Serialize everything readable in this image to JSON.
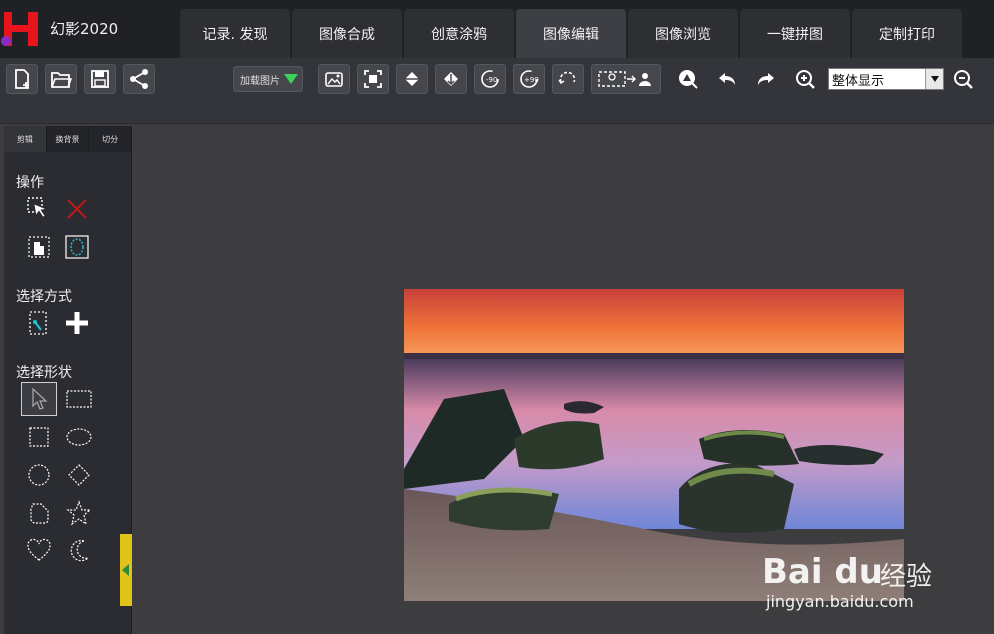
{
  "app": {
    "title": "幻影2020"
  },
  "tabs": [
    {
      "label": "记录. 发现"
    },
    {
      "label": "图像合成"
    },
    {
      "label": "创意涂鸦"
    },
    {
      "label": "图像编辑"
    },
    {
      "label": "图像浏览"
    },
    {
      "label": "一键拼图"
    },
    {
      "label": "定制打印"
    }
  ],
  "active_tab": "图像编辑",
  "toolbar": {
    "load_image_label": "加载图片",
    "zoom_value": "整体显示",
    "icons": [
      "new-file-icon",
      "open-folder-icon",
      "save-icon",
      "share-icon",
      "fit-image-icon",
      "crop-frame-icon",
      "flip-horizontal-icon",
      "flip-vertical-icon",
      "rotate-ccw-90-icon",
      "rotate-cw-90-icon",
      "rotate-free-icon",
      "canvas-person-icon",
      "erase-background-icon",
      "undo-icon",
      "redo-icon",
      "zoom-in-icon",
      "zoom-out-icon"
    ]
  },
  "left_panel": {
    "subtabs": [
      {
        "label": "剪辑"
      },
      {
        "label": "换背景"
      },
      {
        "label": "切分"
      }
    ],
    "sections": {
      "operation": "操作",
      "select_mode": "选择方式",
      "select_shape": "选择形状"
    }
  },
  "watermark": {
    "brand": "Bai du",
    "cn": "经验",
    "url": "jingyan.baidu.com"
  },
  "colors": {
    "titlebar": "#202124",
    "toolbar": "#33353a",
    "panel": "#2b2c31",
    "canvas": "#3d3d3f",
    "handle": "#e0c21a",
    "logo_red": "#e8141b",
    "accent_green": "#3bd15a"
  }
}
